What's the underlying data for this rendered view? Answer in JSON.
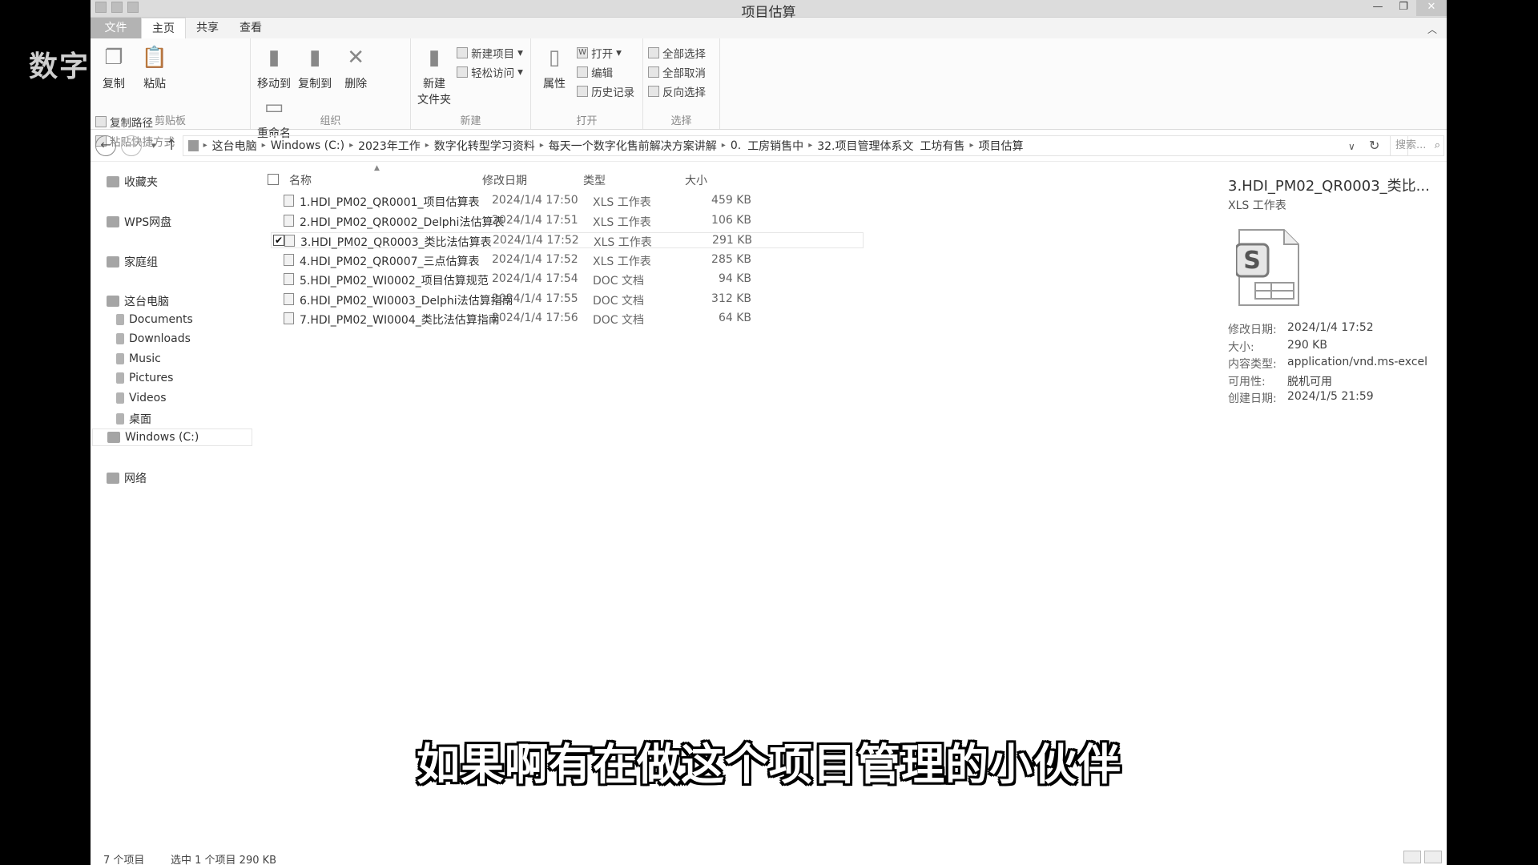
{
  "watermark": "数字",
  "window": {
    "title": "项目估算"
  },
  "ribbon": {
    "tabs": [
      "文件",
      "主页",
      "共享",
      "查看"
    ],
    "clipboard": {
      "group": "剪贴板",
      "copy": "复制",
      "paste": "粘贴",
      "copy_path": "复制路径",
      "paste_shortcut": "粘贴快捷方式"
    },
    "organize": {
      "group": "组织",
      "move_to": "移动到",
      "copy_to": "复制到",
      "delete": "删除",
      "rename": "重命名"
    },
    "new": {
      "group": "新建",
      "new_item": "新建项目",
      "easy_access": "轻松访问",
      "new_folder_1": "新建",
      "new_folder_2": "文件夹"
    },
    "open": {
      "group": "打开",
      "properties": "属性",
      "open": "打开",
      "edit": "编辑",
      "history": "历史记录"
    },
    "select": {
      "group": "选择",
      "select_all": "全部选择",
      "select_none": "全部取消",
      "invert": "反向选择"
    }
  },
  "address": {
    "crumbs": [
      "这台电脑",
      "Windows (C:)",
      "2023年工作",
      "数字化转型学习资料",
      "每天一个数字化售前解决方案讲解",
      "0.",
      "工房销售中",
      "32.项目管理体系文",
      "工坊有售",
      "项目估算"
    ],
    "search_placeholder": "搜索..."
  },
  "nav": {
    "favorites": "收藏夹",
    "wps": "WPS网盘",
    "homegroup": "家庭组",
    "this_pc": "这台电脑",
    "documents": "Documents",
    "downloads": "Downloads",
    "music": "Music",
    "pictures": "Pictures",
    "videos": "Videos",
    "desktop": "桌面",
    "drive": "Windows (C:)",
    "network": "网络"
  },
  "columns": {
    "name": "名称",
    "date": "修改日期",
    "type": "类型",
    "size": "大小"
  },
  "files": [
    {
      "name": "1.HDI_PM02_QR0001_项目估算表",
      "date": "2024/1/4 17:50",
      "type": "XLS 工作表",
      "size": "459 KB",
      "icon": "xls-icon"
    },
    {
      "name": "2.HDI_PM02_QR0002_Delphi法估算表",
      "date": "2024/1/4 17:51",
      "type": "XLS 工作表",
      "size": "106 KB",
      "icon": "xls-icon"
    },
    {
      "name": "3.HDI_PM02_QR0003_类比法估算表",
      "date": "2024/1/4 17:52",
      "type": "XLS 工作表",
      "size": "291 KB",
      "icon": "xls-icon",
      "selected": true
    },
    {
      "name": "4.HDI_PM02_QR0007_三点估算表",
      "date": "2024/1/4 17:52",
      "type": "XLS 工作表",
      "size": "285 KB",
      "icon": "xls-icon"
    },
    {
      "name": "5.HDI_PM02_WI0002_项目估算规范",
      "date": "2024/1/4 17:54",
      "type": "DOC 文档",
      "size": "94 KB",
      "icon": "doc-icon"
    },
    {
      "name": "6.HDI_PM02_WI0003_Delphi法估算指南",
      "date": "2024/1/4 17:55",
      "type": "DOC 文档",
      "size": "312 KB",
      "icon": "doc-icon"
    },
    {
      "name": "7.HDI_PM02_WI0004_类比法估算指南",
      "date": "2024/1/4 17:56",
      "type": "DOC 文档",
      "size": "64 KB",
      "icon": "doc-icon"
    }
  ],
  "details": {
    "title": "3.HDI_PM02_QR0003_类比...",
    "type": "XLS 工作表",
    "modified_label": "修改日期:",
    "modified": "2024/1/4 17:52",
    "size_label": "大小:",
    "size": "290 KB",
    "content_type_label": "内容类型:",
    "content_type": "application/vnd.ms-excel",
    "availability_label": "可用性:",
    "availability": "脱机可用",
    "created_label": "创建日期:",
    "created": "2024/1/5 21:59"
  },
  "status": {
    "count": "7 个项目",
    "selected": "选中 1 个项目  290 KB"
  },
  "subtitle": "如果啊有在做这个项目管理的小伙伴"
}
